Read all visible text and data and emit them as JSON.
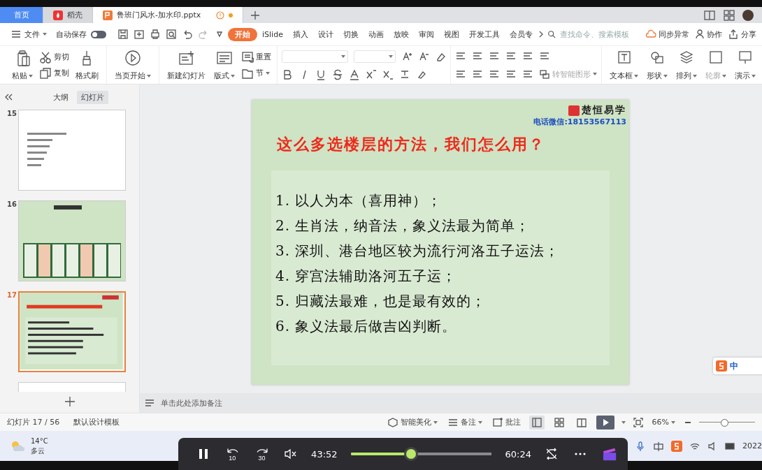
{
  "tabs": [
    {
      "kind": "home",
      "label": "首页",
      "selected": false
    },
    {
      "kind": "app",
      "label": "稻壳",
      "selected": false
    },
    {
      "kind": "doc",
      "label": "鲁班门风水-加水印.pptx",
      "selected": true,
      "unsaved": true
    }
  ],
  "menu": {
    "file": "文件",
    "autosave": {
      "label": "自动保存",
      "on": false
    },
    "tabs": [
      {
        "label": "开始",
        "selected": true
      },
      {
        "label": "iSlide",
        "selected": false
      },
      {
        "label": "插入",
        "selected": false
      },
      {
        "label": "设计",
        "selected": false
      },
      {
        "label": "切换",
        "selected": false
      },
      {
        "label": "动画",
        "selected": false
      },
      {
        "label": "放映",
        "selected": false
      },
      {
        "label": "审阅",
        "selected": false
      },
      {
        "label": "视图",
        "selected": false
      },
      {
        "label": "开发工具",
        "selected": false
      },
      {
        "label": "会员专",
        "selected": false
      }
    ],
    "search": {
      "placeholder": "查找命令、搜索模板"
    },
    "sync": "同步异常",
    "collab": "协作",
    "share": "分享"
  },
  "ribbon": {
    "left": [
      {
        "kind": "large",
        "label": "粘贴",
        "dropdown": true
      },
      {
        "kind": "small",
        "label": "剪切",
        "dropdown": false
      },
      {
        "kind": "small",
        "label": "复制",
        "dropdown": false
      },
      {
        "kind": "large",
        "label": "格式刷",
        "dropdown": false
      },
      {
        "kind": "large",
        "label": "当页开始",
        "dropdown": true
      },
      {
        "kind": "large",
        "label": "新建幻灯片",
        "dropdown": false
      },
      {
        "kind": "large",
        "label": "版式",
        "dropdown": true
      },
      {
        "kind": "small",
        "label": "重置",
        "dropdown": false
      },
      {
        "kind": "small",
        "label": "节",
        "dropdown": true
      }
    ],
    "smart_art": {
      "label": "转智能图形",
      "disabled": true
    },
    "right": [
      {
        "label": "文本框",
        "disabled": false
      },
      {
        "label": "形状",
        "disabled": false
      },
      {
        "label": "排列",
        "disabled": false
      },
      {
        "label": "轮廓",
        "disabled": true
      },
      {
        "label": "演示",
        "disabled": false
      }
    ]
  },
  "sidebar": {
    "tabs": [
      {
        "label": "大纲",
        "selected": false
      },
      {
        "label": "幻灯片",
        "selected": true
      }
    ],
    "slides": [
      {
        "number": "15",
        "selected": false,
        "kind": "text"
      },
      {
        "number": "16",
        "selected": false,
        "kind": "table"
      },
      {
        "number": "17",
        "selected": true,
        "kind": "list"
      }
    ]
  },
  "slide": {
    "brand": "楚恒易学",
    "contact": "电话微信:18153567113",
    "title": "这么多选楼层的方法，我们怎么用？",
    "items": [
      "1. 以人为本（喜用神）；",
      "2. 生肖法，纳音法，象义法最为简单；",
      "3. 深圳、港台地区较为流行河洛五子运法；",
      "4. 穿宫法辅助洛河五子运；",
      "5. 归藏法最难，也是最有效的；",
      "6. 象义法最后做吉凶判断。"
    ]
  },
  "notes": {
    "placeholder": "单击此处添加备注"
  },
  "ime": {
    "mode": "中"
  },
  "status_bar": {
    "slide_counter": "幻灯片 17 / 56",
    "template": "默认设计模板",
    "beautify": "智能美化",
    "notes": "备注",
    "comments": "批注",
    "views": [
      {
        "selected": true
      },
      {
        "selected": false
      },
      {
        "selected": false
      }
    ],
    "zoom": "66%",
    "zoom_level": {
      "level": 0.45
    }
  },
  "taskbar": {
    "temperature": "14°C",
    "weather": "多云",
    "clock": "2022"
  },
  "player": {
    "rewind": "10",
    "forward": "30",
    "current": "43:52",
    "total": "60:24",
    "progress": {
      "level": 0.43
    }
  }
}
